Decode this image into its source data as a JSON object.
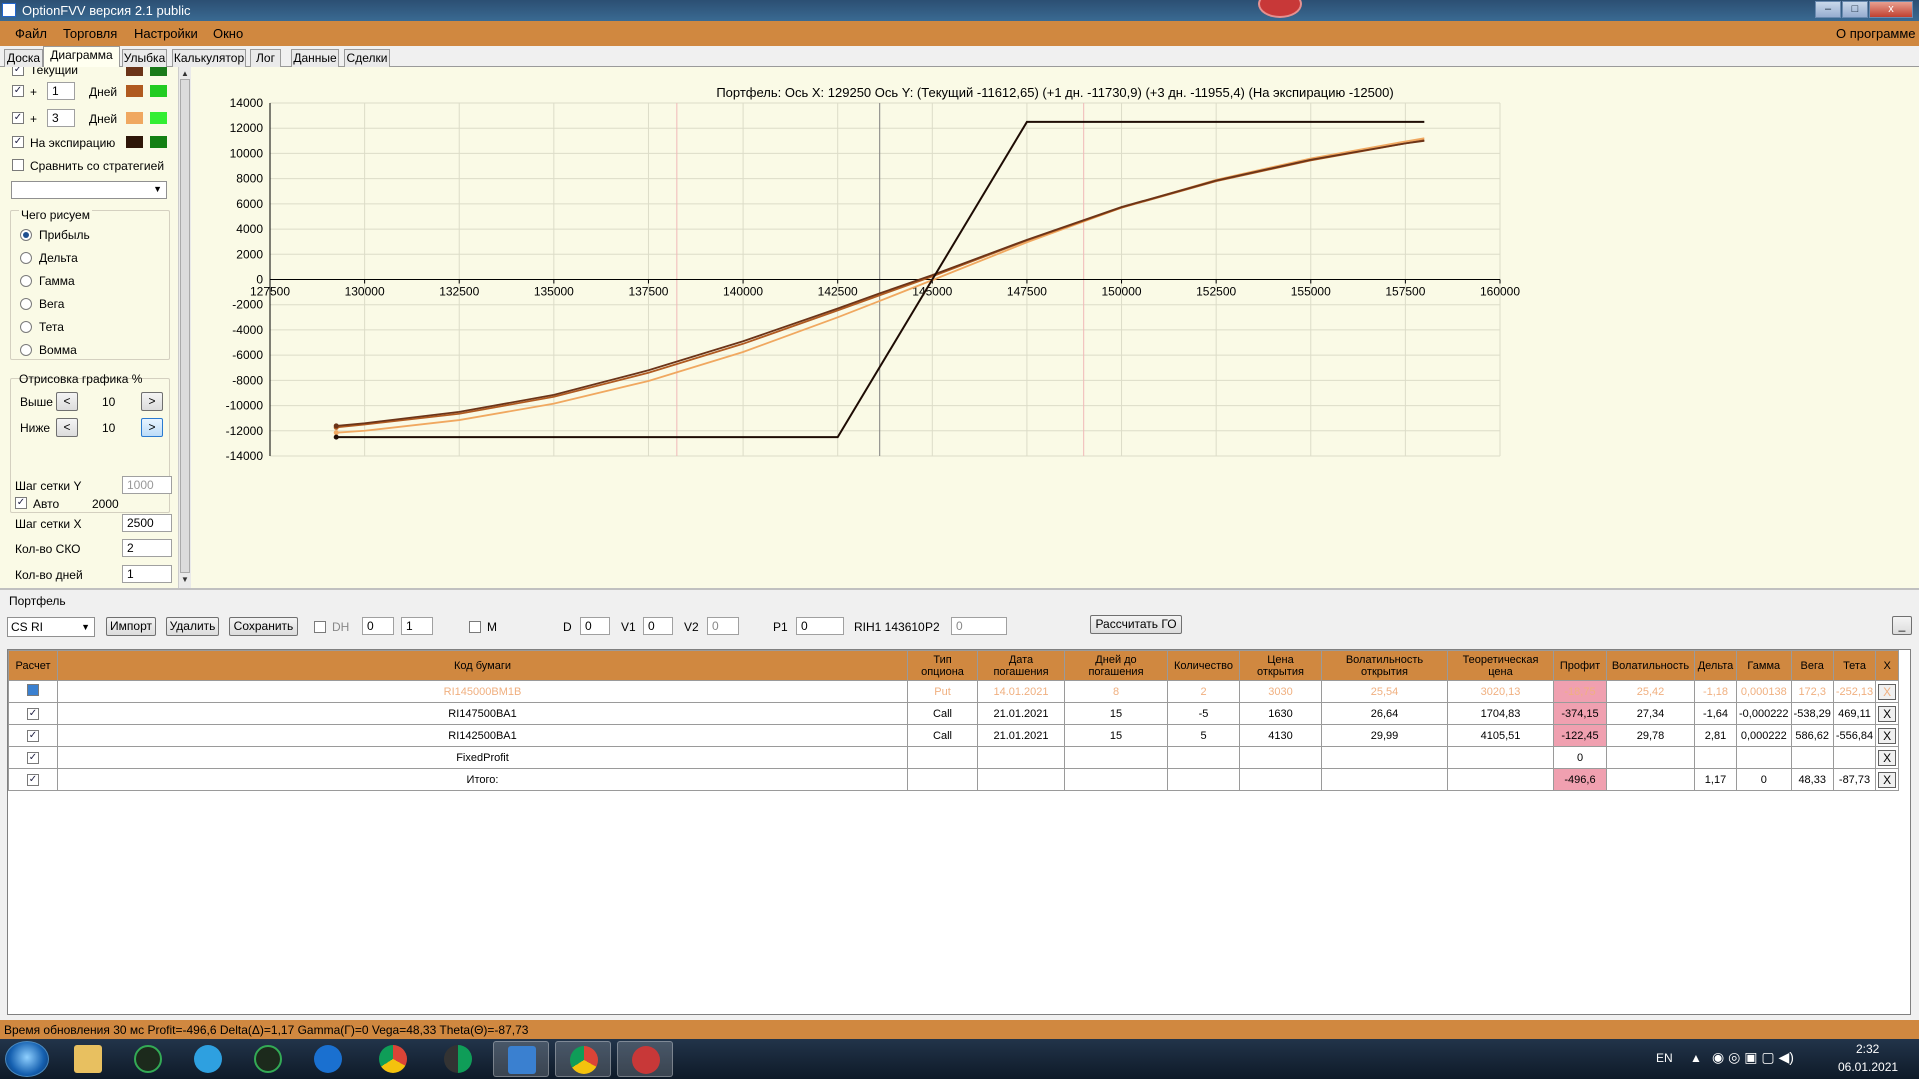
{
  "window": {
    "title": "OptionFVV версия 2.1 public",
    "minimize": "–",
    "maximize": "□",
    "close": "x"
  },
  "menu": {
    "items": [
      "Файл",
      "Торговля",
      "Настройки",
      "Окно"
    ],
    "about": "О программе"
  },
  "tabs": [
    "Доска",
    "Диаграмма",
    "Улыбка",
    "Калькулятор",
    "Лог",
    "Данные",
    "Сделки"
  ],
  "left": {
    "rows": [
      {
        "check": true,
        "plus": "",
        "days": "",
        "label": "Текущий",
        "c1": "#6b3418",
        "c2": "#1a7a1a"
      },
      {
        "check": true,
        "plus": "+",
        "days": "1",
        "label": "Дней",
        "c1": "#b05a20",
        "c2": "#22cc22"
      },
      {
        "check": true,
        "plus": "+",
        "days": "3",
        "label": "Дней",
        "c1": "#f0a860",
        "c2": "#33ee33"
      },
      {
        "check": true,
        "plus": "",
        "days": "",
        "label": "На экспирацию",
        "c1": "#2e1608",
        "c2": "#138013"
      }
    ],
    "compare": "Сравнить со стратегией",
    "what_title": "Чего рисуем",
    "what": [
      {
        "label": "Прибыль",
        "on": true
      },
      {
        "label": "Дельта",
        "on": false
      },
      {
        "label": "Гамма",
        "on": false
      },
      {
        "label": "Вега",
        "on": false
      },
      {
        "label": "Тета",
        "on": false
      },
      {
        "label": "Вомма",
        "on": false
      }
    ],
    "render_title": "Отрисовка графика %",
    "above_label": "Выше",
    "above_value": "10",
    "below_label": "Ниже",
    "below_value": "10",
    "prev": "<",
    "next": ">",
    "gridy_label": "Шаг сетки Y",
    "gridy_value": "1000",
    "auto_label": "Авто",
    "auto_value": "2000",
    "gridx_label": "Шаг сетки X",
    "gridx_value": "2500",
    "sko_label": "Кол-во СКО",
    "sko_value": "2",
    "days_label": "Кол-во дней",
    "days_value": "1"
  },
  "chart_data": {
    "type": "line",
    "title": "Портфель: Ось Х: 129250 Ось Y:  (Текущий -11612,65)  (+1 дн. -11730,9)  (+3 дн. -11955,4)  (На экспирацию -12500)",
    "xlim": [
      127500,
      160000
    ],
    "ylim": [
      -14000,
      14000
    ],
    "xticks": [
      127500,
      130000,
      132500,
      135000,
      137500,
      140000,
      142500,
      145000,
      147500,
      150000,
      152500,
      155000,
      157500,
      160000
    ],
    "yticks": [
      14000,
      12000,
      10000,
      8000,
      6000,
      4000,
      2000,
      0,
      -2000,
      -4000,
      -6000,
      -8000,
      -10000,
      -12000,
      -14000
    ],
    "vlines": [
      {
        "x": 138250,
        "color": "#f0b8b8"
      },
      {
        "x": 143610,
        "color": "#808080"
      },
      {
        "x": 149000,
        "color": "#f0b8b8"
      }
    ],
    "grid": true,
    "series": [
      {
        "color": "#f0a860",
        "x": [
          129250,
          130000,
          132500,
          135000,
          137500,
          140000,
          142500,
          143610,
          145000,
          147500,
          150000,
          152500,
          155000,
          157500,
          158000
        ],
        "y": [
          -12150,
          -12000,
          -11150,
          -9850,
          -8050,
          -5750,
          -3000,
          -1700,
          -50,
          2950,
          5700,
          7900,
          9600,
          10950,
          11200
        ]
      },
      {
        "color": "#b05a20",
        "x": [
          129250,
          130000,
          132500,
          135000,
          137500,
          140000,
          142500,
          143610,
          145000,
          147500,
          150000,
          152500,
          155000,
          157500,
          158000
        ],
        "y": [
          -11730,
          -11500,
          -10650,
          -9300,
          -7400,
          -5100,
          -2450,
          -1250,
          250,
          3100,
          5700,
          7800,
          9450,
          10800,
          11050
        ]
      },
      {
        "color": "#6b3418",
        "x": [
          129250,
          130000,
          132500,
          135000,
          137500,
          140000,
          142500,
          143610,
          145000,
          147500,
          150000,
          152500,
          155000,
          157500,
          158000
        ],
        "y": [
          -11612,
          -11400,
          -10500,
          -9150,
          -7200,
          -4900,
          -2300,
          -1100,
          350,
          3150,
          5750,
          7850,
          9500,
          10800,
          11000
        ]
      },
      {
        "color": "#1e0c04",
        "x": [
          129250,
          130000,
          132500,
          135000,
          137500,
          140000,
          142500,
          145000,
          147500,
          150000,
          152500,
          155000,
          157500,
          158000
        ],
        "y": [
          -12500,
          -12500,
          -12500,
          -12500,
          -12500,
          -12500,
          -12500,
          0,
          12500,
          12500,
          12500,
          12500,
          12500,
          12500
        ]
      }
    ]
  },
  "portfolio": {
    "label": "Портфель",
    "instrument": "CS RI",
    "import": "Импорт",
    "delete": "Удалить",
    "save": "Сохранить",
    "dh_label": "DH",
    "dh_a": "0",
    "dh_b": "1",
    "m_label": "M",
    "d_label": "D",
    "d_value": "0",
    "v1_label": "V1",
    "v1_value": "0",
    "v2_label": "V2",
    "v2_value": "0",
    "p1_label": "P1",
    "p1_value": "0",
    "rih": "RIH1 143610",
    "p2_label": "P2",
    "p2_value": "0",
    "calc_go": "Рассчитать ГО",
    "collapse": "_"
  },
  "table": {
    "headers": [
      "Расчет",
      "Код бумаги",
      "Тип\nопциона",
      "Дата\nпогашения",
      "Дней до\nпогашения",
      "Количество",
      "Цена\nоткрытия",
      "Волатильность\nоткрытия",
      "Теоретическая\nцена",
      "Профит",
      "Волатильность",
      "Дельта",
      "Гамма",
      "Вега",
      "Тета",
      "X"
    ],
    "rows": [
      {
        "check": false,
        "faded": true,
        "cells": [
          "RI145000BM1B",
          "Put",
          "14.01.2021",
          "8",
          "2",
          "3030",
          "25,54",
          "3020,13",
          "-18,75",
          "25,42",
          "-1,18",
          "0,000138",
          "172,3",
          "-252,13"
        ],
        "pinkProfit": true
      },
      {
        "check": true,
        "faded": false,
        "cells": [
          "RI147500BA1",
          "Call",
          "21.01.2021",
          "15",
          "-5",
          "1630",
          "26,64",
          "1704,83",
          "-374,15",
          "27,34",
          "-1,64",
          "-0,000222",
          "-538,29",
          "469,11"
        ],
        "pinkProfit": true
      },
      {
        "check": true,
        "faded": false,
        "cells": [
          "RI142500BA1",
          "Call",
          "21.01.2021",
          "15",
          "5",
          "4130",
          "29,99",
          "4105,51",
          "-122,45",
          "29,78",
          "2,81",
          "0,000222",
          "586,62",
          "-556,84"
        ],
        "pinkProfit": true
      },
      {
        "check": true,
        "faded": false,
        "cells": [
          "FixedProfit",
          "",
          "",
          "",
          "",
          "",
          "",
          "",
          "0",
          "",
          "",
          "",
          "",
          ""
        ],
        "pinkProfit": false
      },
      {
        "check": true,
        "faded": false,
        "cells": [
          "Итого:",
          "",
          "",
          "",
          "",
          "",
          "",
          "",
          "-496,6",
          "",
          "1,17",
          "0",
          "48,33",
          "-87,73"
        ],
        "pinkProfit": true
      }
    ],
    "x": "X"
  },
  "status": "Время обновления 30 мс  Profit=-496,6 Delta(Δ)=1,17 Gamma(Γ)=0 Vega=48,33 Theta(Θ)=-87,73",
  "taskbar": {
    "lang": "EN",
    "time": "2:32",
    "date": "06.01.2021"
  }
}
